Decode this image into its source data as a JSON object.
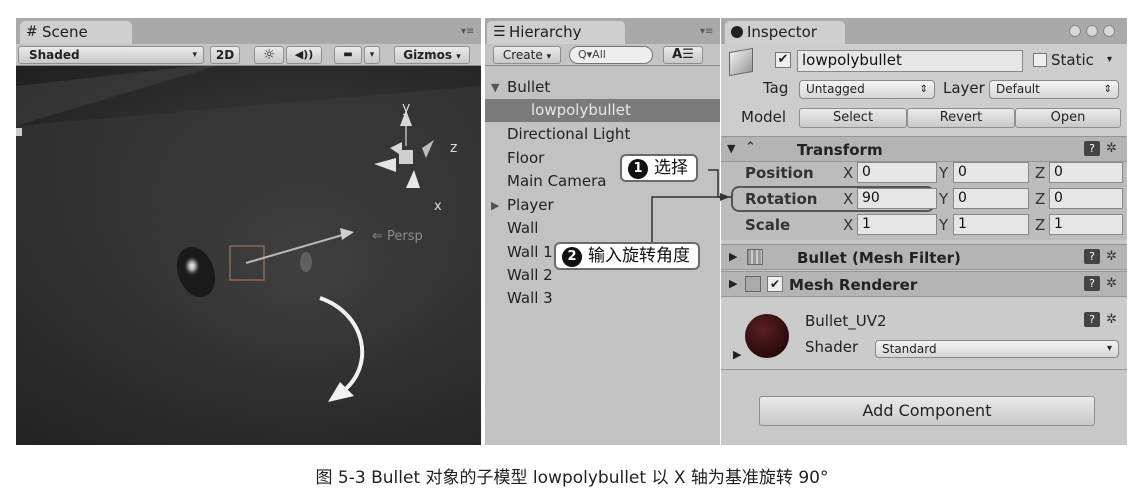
{
  "scene": {
    "tab_label": "Scene",
    "tab_icon": "#",
    "shading_mode": "Shaded",
    "btn_2d": "2D",
    "btn_light": "☼",
    "btn_audio": "◀))",
    "btn_fx": "▬",
    "btn_gizmos": "Gizmos",
    "gizmo_y": "y",
    "gizmo_z": "z",
    "gizmo_x": "x",
    "persp": "Persp"
  },
  "hierarchy": {
    "tab_label": "Hierarchy",
    "tab_icon": "☰",
    "create_label": "Create",
    "search_placeholder": "Q▾All",
    "items": [
      {
        "label": "Bullet"
      },
      {
        "label": "lowpolybullet"
      },
      {
        "label": "Directional Light"
      },
      {
        "label": "Floor"
      },
      {
        "label": "Main Camera"
      },
      {
        "label": "Player"
      },
      {
        "label": "Wall"
      },
      {
        "label": "Wall 1"
      },
      {
        "label": "Wall 2"
      },
      {
        "label": "Wall 3"
      }
    ]
  },
  "inspector": {
    "tab_label": "Inspector",
    "object_name": "lowpolybullet",
    "static_label": "Static",
    "tag_label": "Tag",
    "tag_value": "Untagged",
    "layer_label": "Layer",
    "layer_value": "Default",
    "model_label": "Model",
    "btn_select": "Select",
    "btn_revert": "Revert",
    "btn_open": "Open",
    "transform_title": "Transform",
    "position_label": "Position",
    "rotation_label": "Rotation",
    "scale_label": "Scale",
    "axis_x": "X",
    "axis_y": "Y",
    "axis_z": "Z",
    "position": {
      "x": "0",
      "y": "0",
      "z": "0"
    },
    "rotation": {
      "x": "90",
      "y": "0",
      "z": "0"
    },
    "scale": {
      "x": "1",
      "y": "1",
      "z": "1"
    },
    "mesh_filter_title": "Bullet (Mesh Filter)",
    "mesh_renderer_title": "Mesh Renderer",
    "material_name": "Bullet_UV2",
    "shader_label": "Shader",
    "shader_value": "Standard",
    "add_component": "Add Component"
  },
  "callouts": {
    "c1_num": "1",
    "c1_text": "选择",
    "c2_num": "2",
    "c2_text": "输入旋转角度"
  },
  "caption": "图 5-3   Bullet 对象的子模型 lowpolybullet 以 X 轴为基准旋转 90°",
  "colors": {
    "scene_bg": "#2b2c2c",
    "selection": "#7b7b7b",
    "panel_bg": "#c2c2c2"
  }
}
